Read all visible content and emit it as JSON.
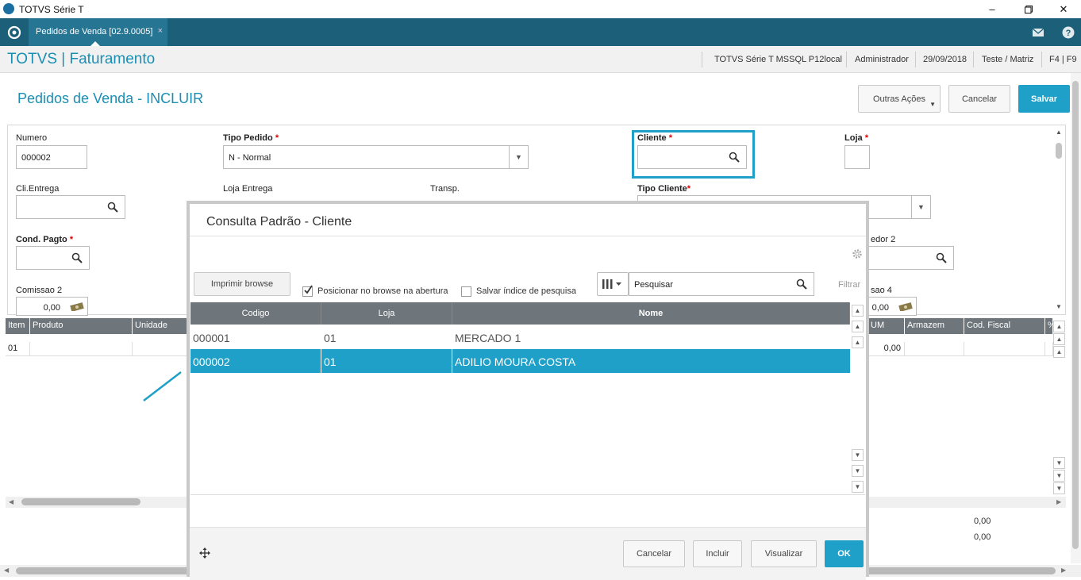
{
  "window": {
    "title": "TOTVS Série T"
  },
  "tabbar": {
    "tab_label": "Pedidos de Venda [02.9.0005]",
    "tab_close": "×"
  },
  "header": {
    "brand": "TOTVS | Faturamento",
    "environment": "TOTVS Série T  MSSQL P12local",
    "user": "Administrador",
    "date": "29/09/2018",
    "branch": "Teste / Matriz",
    "shortcuts": "F4 | F9"
  },
  "page": {
    "title": "Pedidos de Venda - INCLUIR",
    "actions": {
      "other": "Outras Ações",
      "cancel": "Cancelar",
      "save": "Salvar"
    }
  },
  "form": {
    "numero_label": "Numero",
    "numero_value": "000002",
    "tipo_pedido_label": "Tipo Pedido",
    "tipo_pedido_value": "N - Normal",
    "cliente_label": "Cliente",
    "loja_label": "Loja",
    "cli_entrega_label": "Cli.Entrega",
    "loja_entrega_label": "Loja Entrega",
    "transp_label": "Transp.",
    "tipo_cliente_label": "Tipo Cliente",
    "cond_pagto_label": "Cond. Pagto",
    "vendedor2_label": "edor 2",
    "comissao2_label": "Comissao 2",
    "comissao2_value": "0,00",
    "comissao4_label": "sao 4",
    "comissao4_value": "0,00",
    "required_mark": "*"
  },
  "grid": {
    "left_headers": [
      "Item",
      "Produto",
      "Unidade"
    ],
    "right_headers": [
      "UM",
      "Armazem",
      "Cod. Fiscal",
      "%"
    ],
    "row": {
      "item": "01",
      "um_value": "0,00"
    }
  },
  "totals": {
    "value1": "0,00",
    "value2": "0,00"
  },
  "modal": {
    "title": "Consulta Padrão - Cliente",
    "print_button": "Imprimir browse",
    "check_position_label": "Posicionar no browse na abertura",
    "check_position_checked": true,
    "check_save_index_label": "Salvar índice de pesquisa",
    "search_placeholder": "Pesquisar",
    "filter_label": "Filtrar",
    "columns": [
      "Codigo",
      "Loja",
      "Nome"
    ],
    "rows": [
      {
        "codigo": "000001",
        "loja": "01",
        "nome": "MERCADO 1"
      },
      {
        "codigo": "000002",
        "loja": "01",
        "nome": "ADILIO MOURA COSTA"
      }
    ],
    "selected_row": 1,
    "buttons": {
      "cancel": "Cancelar",
      "include": "Incluir",
      "view": "Visualizar",
      "ok": "OK"
    }
  },
  "colors": {
    "accent": "#1fa0c8",
    "tabbar": "#1b5f78",
    "grid_header": "#6f767b",
    "highlight_border": "#1fa0c8"
  }
}
